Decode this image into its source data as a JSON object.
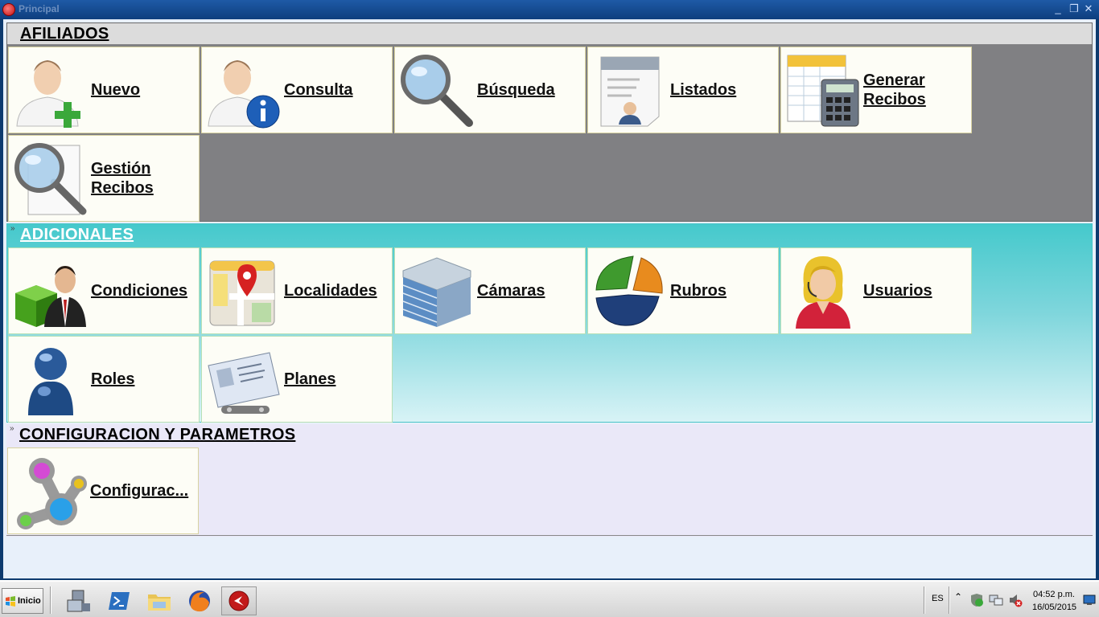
{
  "window": {
    "title": "Principal"
  },
  "sections": {
    "afiliados": {
      "title": "AFILIADOS",
      "tiles": [
        {
          "label": "Nuevo",
          "icon": "user-add-icon"
        },
        {
          "label": "Consulta",
          "icon": "user-info-icon"
        },
        {
          "label": "Búsqueda",
          "icon": "magnifier-icon"
        },
        {
          "label": "Listados",
          "icon": "document-list-icon"
        },
        {
          "label": "Generar\nRecibos",
          "icon": "calculator-spreadsheet-icon"
        },
        {
          "label": "Gestión\nRecibos",
          "icon": "document-search-icon"
        }
      ]
    },
    "adicionales": {
      "title": "ADICIONALES",
      "tiles": [
        {
          "label": "Condiciones",
          "icon": "cube-businessman-icon"
        },
        {
          "label": "Localidades",
          "icon": "map-pin-icon"
        },
        {
          "label": "Cámaras",
          "icon": "building-icon"
        },
        {
          "label": "Rubros",
          "icon": "pie-chart-icon"
        },
        {
          "label": "Usuarios",
          "icon": "support-agent-icon"
        },
        {
          "label": "Roles",
          "icon": "user-silhouette-icon"
        },
        {
          "label": "Planes",
          "icon": "id-card-icon"
        }
      ]
    },
    "config": {
      "title": "CONFIGURACION Y PARAMETROS",
      "tiles": [
        {
          "label": "Configurac...",
          "icon": "settings-nodes-icon"
        }
      ]
    }
  },
  "taskbar": {
    "start_label": "Inicio",
    "apps": [
      "server-manager-icon",
      "powershell-icon",
      "file-explorer-icon",
      "firefox-icon",
      "principal-app-icon"
    ],
    "language": "ES",
    "time": "04:52 p.m.",
    "date": "16/05/2015"
  },
  "colors": {
    "titlebar": "#1e5aa6",
    "afiliados_bg": "#808083",
    "adicionales_bg": "#45c9cc",
    "config_bg": "#eae8f8",
    "tile_bg": "#fdfdf6"
  }
}
